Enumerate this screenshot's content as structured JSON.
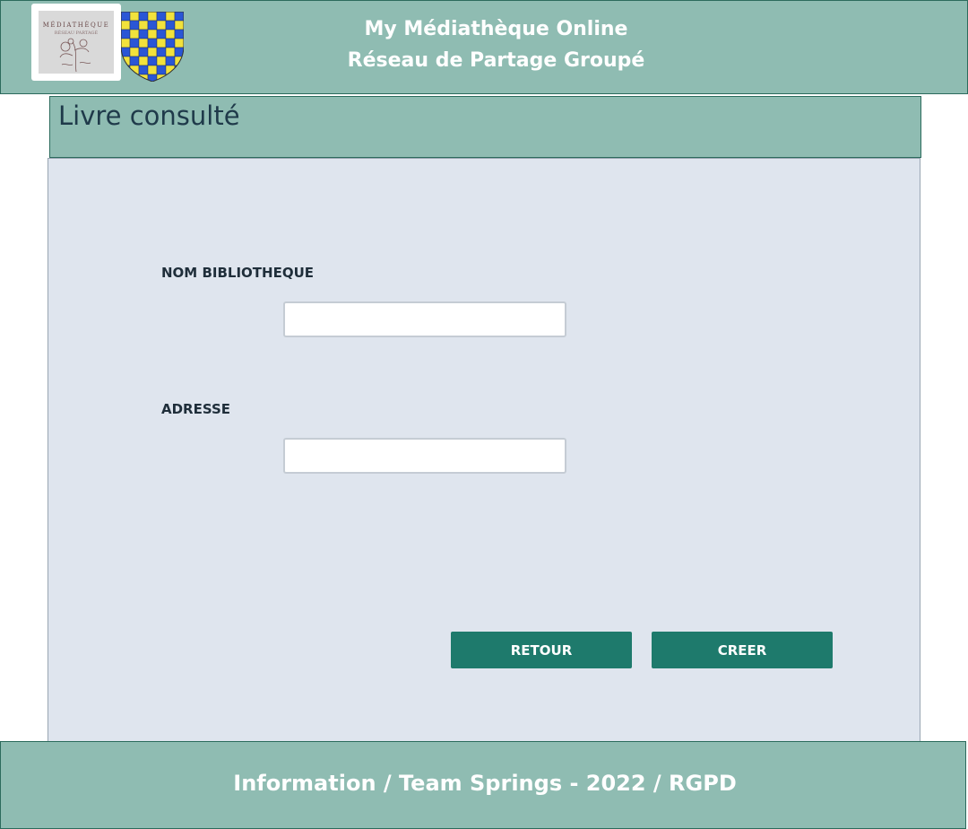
{
  "header": {
    "logo_text": "MÉDIATHÈQUE",
    "logo_subtext": "RÉSEAU PARTAGÉ",
    "title_line1": "My Médiathèque Online",
    "title_line2": "Réseau de Partage Groupé",
    "shield_colors": [
      "#2a56d6",
      "#f2e23c"
    ]
  },
  "page": {
    "title": "Livre consulté"
  },
  "form": {
    "fields": [
      {
        "label": "NOM BIBLIOTHEQUE",
        "value": "",
        "placeholder": ""
      },
      {
        "label": "ADRESSE",
        "value": "",
        "placeholder": ""
      }
    ],
    "buttons": {
      "back_label": "RETOUR",
      "create_label": "CREER"
    }
  },
  "footer": {
    "text": "Information / Team Springs - 2022 / RGPD"
  },
  "colors": {
    "header_bg": "#8fbcb2",
    "panel_bg": "#dfe5ee",
    "button_bg": "#1e7a6c"
  }
}
